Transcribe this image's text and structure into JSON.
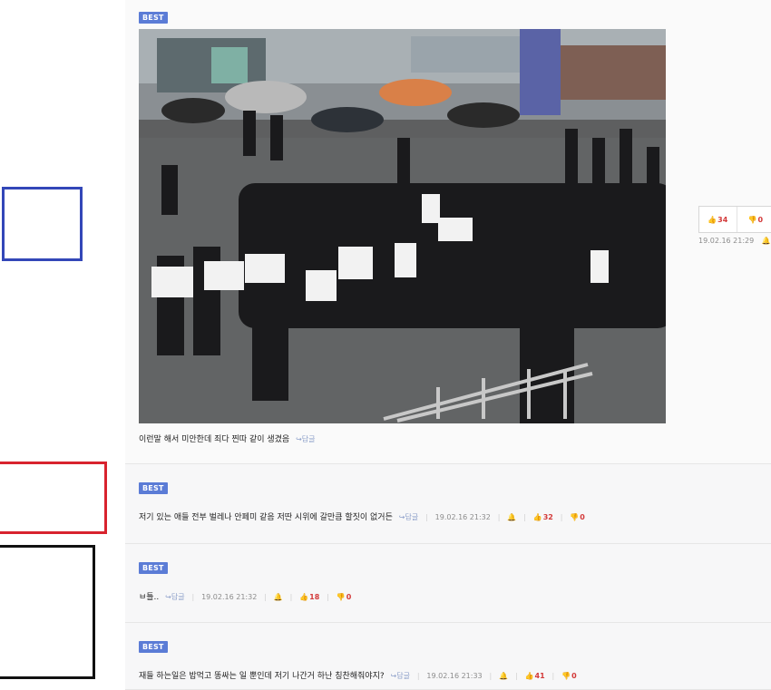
{
  "colors": {
    "best_badge": "#5b7cd6",
    "blue_box": "#3347b8",
    "red_box": "#d8232e",
    "black_box": "#111111",
    "vote_count": "#d33a3a"
  },
  "icons": {
    "reply": "reply-arrow-icon",
    "like": "thumbs-up-icon",
    "dislike": "thumbs-down-icon",
    "report": "bell-icon"
  },
  "comments": [
    {
      "badge": "BEST",
      "text": "이런말 해서 미안한데 죄다 찐따 같이 생겼음",
      "reply": "답글",
      "date": "19.02.16 21:29",
      "likes": "34",
      "dislikes": "0"
    },
    {
      "badge": "BEST",
      "text": "저기 있는 애들 전부 벌레나 안페미 같음 저딴 시위에 갈만큼 할짓이 없거든",
      "reply": "답글",
      "date": "19.02.16 21:32",
      "likes": "32",
      "dislikes": "0"
    },
    {
      "badge": "BEST",
      "text": "ㅂ틀..",
      "reply": "답글",
      "date": "19.02.16 21:32",
      "likes": "18",
      "dislikes": "0"
    },
    {
      "badge": "BEST",
      "text": "재들 하는일은 밥먹고 똥싸는 일 뿐인데 저기 나간거 하난 칭찬해줘야지?",
      "reply": "답글",
      "date": "19.02.16 21:33",
      "likes": "41",
      "dislikes": "0"
    }
  ]
}
